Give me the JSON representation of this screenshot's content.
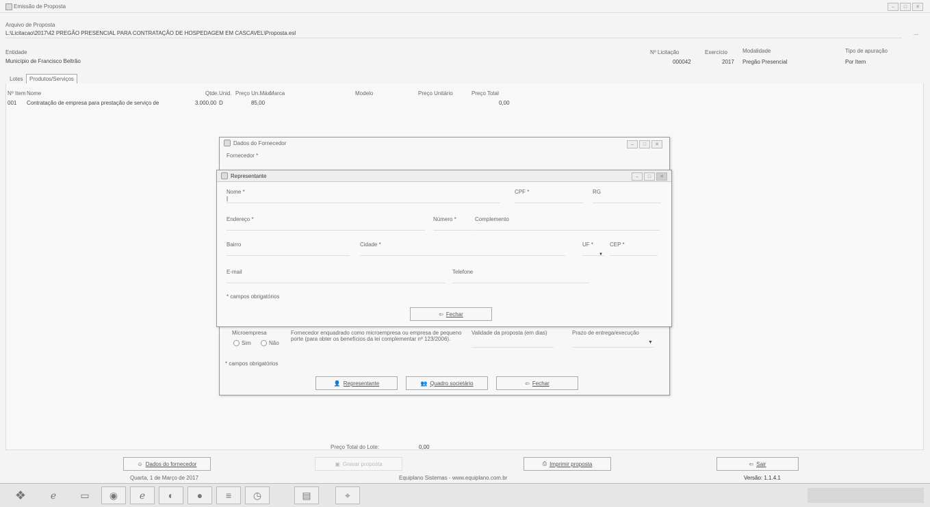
{
  "window": {
    "title": "Emissão de Proposta",
    "controls": [
      "–",
      "□",
      "✕"
    ]
  },
  "file": {
    "label": "Arquivo de Proposta",
    "path": "L:\\Licitacao\\2017\\42 PREGÃO PRESENCIAL PARA CONTRATAÇÃO DE HOSPEDAGEM EM CASCAVEL\\Proposta.esl",
    "browse": "..."
  },
  "entity": {
    "label": "Entidade",
    "value": "Município de Francisco Beltrão"
  },
  "licitacao": {
    "numero_label": "Nº Licitação",
    "numero_value": "000042",
    "exercicio_label": "Exercício",
    "exercicio_value": "2017",
    "modalidade_label": "Modalidade",
    "modalidade_value": "Pregão Presencial",
    "apuracao_label": "Tipo de apuração",
    "apuracao_value": "Por Item"
  },
  "tabs": [
    {
      "label": "Lotes"
    },
    {
      "label": "Produtos/Serviços"
    }
  ],
  "table": {
    "columns": [
      "Nº Item",
      "Nome",
      "Qtde.",
      "Unid.",
      "Preço Un.Máx.",
      "Marca",
      "Modelo",
      "Preço Unitário",
      "Preço Total"
    ],
    "rows": [
      {
        "item": "001",
        "nome": "Contratação de empresa para prestação de serviço de",
        "qtde": "3.000,00",
        "unid": "D",
        "preco_max": "85,00",
        "marca": "",
        "modelo": "",
        "preco_unit": "",
        "preco_total": "0,00"
      }
    ]
  },
  "fornecedor_dialog": {
    "title": "Dados do Fornecedor",
    "fornecedor_label": "Fornecedor *",
    "microempresa_label": "Microempresa",
    "sim": "Sim",
    "nao": "Não",
    "microempresa_text": "Fornecedor enquadrado como microempresa ou empresa de pequeno porte (para obter os benefícios da lei complementar nº 123/2006).",
    "validade_label": "Validade da proposta (em dias)",
    "prazo_label": "Prazo de entrega/execução",
    "required_note": "* campos obrigatórios",
    "btn_representante": "Representante",
    "btn_quadro": "Quadro societário",
    "btn_fechar": "Fechar"
  },
  "representante_dialog": {
    "title": "Representante",
    "nome": "Nome *",
    "cpf": "CPF *",
    "rg": "RG",
    "endereco": "Endereço *",
    "numero": "Número *",
    "complemento": "Complemento",
    "bairro": "Bairro",
    "cidade": "Cidade *",
    "uf": "UF *",
    "cep": "CEP *",
    "email": "E-mail",
    "telefone": "Telefone",
    "required_note": "* campos obrigatórios",
    "btn_fechar": "Fechar"
  },
  "footer": {
    "preco_total_label": "Preço Total do Lote:",
    "preco_total_value": "0,00",
    "btn_dados": "Dados do fornecedor",
    "btn_disabled": "Gravar proposta",
    "btn_imprimir": "Imprimir proposta",
    "btn_sair": "Sair",
    "date": "Quarta, 1 de Março de 2017",
    "company": "Equiplano Sistemas - www.equiplano.com.br",
    "version": "Versão: 1.1.4.1"
  },
  "taskbar": {
    "icons": [
      "start-icon",
      "ie-icon",
      "folder-icon",
      "chrome-icon",
      "explorer-icon",
      "firefox-icon",
      "app-icon",
      "clock-icon",
      "image-icon",
      "java-icon",
      "tag-icon"
    ]
  }
}
